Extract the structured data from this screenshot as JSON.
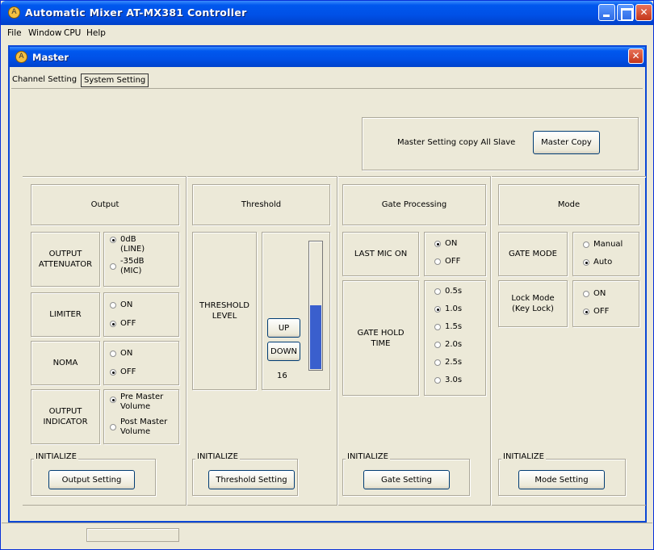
{
  "app": {
    "title": "Automatic Mixer AT-MX381 Controller",
    "logo_glyph": "A",
    "min_icon": "minimize-icon",
    "max_icon": "maximize-icon",
    "close_icon": "close-icon",
    "close_glyph": "✕"
  },
  "menu": {
    "file": "File",
    "window": "Window",
    "cpu": "CPU",
    "help": "Help"
  },
  "child": {
    "title": "Master"
  },
  "tabs": {
    "channel_setting": "Channel Setting",
    "system_setting": "System Setting"
  },
  "master_copy": {
    "label": "Master Setting copy All Slave",
    "button": "Master Copy"
  },
  "output": {
    "header": "Output",
    "attenuator": {
      "label_line1": "OUTPUT",
      "label_line2": "ATTENUATOR",
      "opt1_line1": "0dB",
      "opt1_line2": "(LINE)",
      "opt2_line1": "-35dB",
      "opt2_line2": "(MIC)",
      "selected": "0dB (LINE)"
    },
    "limiter": {
      "label": "LIMITER",
      "on": "ON",
      "off": "OFF",
      "selected": "OFF"
    },
    "noma": {
      "label": "NOMA",
      "on": "ON",
      "off": "OFF",
      "selected": "OFF"
    },
    "indicator": {
      "label_line1": "OUTPUT",
      "label_line2": "INDICATOR",
      "opt1_line1": "Pre Master",
      "opt1_line2": "Volume",
      "opt2_line1": "Post Master",
      "opt2_line2": "Volume",
      "selected": "Pre Master Volume"
    },
    "initialize_legend": "INITIALIZE",
    "button": "Output Setting"
  },
  "threshold": {
    "header": "Threshold",
    "label_line1": "THRESHOLD",
    "label_line2": "LEVEL",
    "up": "UP",
    "down": "DOWN",
    "value": "16",
    "level_fraction": 0.5,
    "bar_color": "#3a5fcd",
    "initialize_legend": "INITIALIZE",
    "button": "Threshold Setting"
  },
  "gate": {
    "header": "Gate Processing",
    "last_mic": {
      "label": "LAST MIC ON",
      "on": "ON",
      "off": "OFF",
      "selected": "ON"
    },
    "hold": {
      "label_line1": "GATE HOLD",
      "label_line2": "TIME",
      "options": [
        "0.5s",
        "1.0s",
        "1.5s",
        "2.0s",
        "2.5s",
        "3.0s"
      ],
      "selected": "1.0s"
    },
    "initialize_legend": "INITIALIZE",
    "button": "Gate Setting"
  },
  "mode": {
    "header": "Mode",
    "gate_mode": {
      "label": "GATE MODE",
      "manual": "Manual",
      "auto": "Auto",
      "selected": "Auto"
    },
    "lock_mode": {
      "label_line1": "Lock Mode",
      "label_line2": "(Key Lock)",
      "on": "ON",
      "off": "OFF",
      "selected": "OFF"
    },
    "initialize_legend": "INITIALIZE",
    "button": "Mode Setting"
  }
}
